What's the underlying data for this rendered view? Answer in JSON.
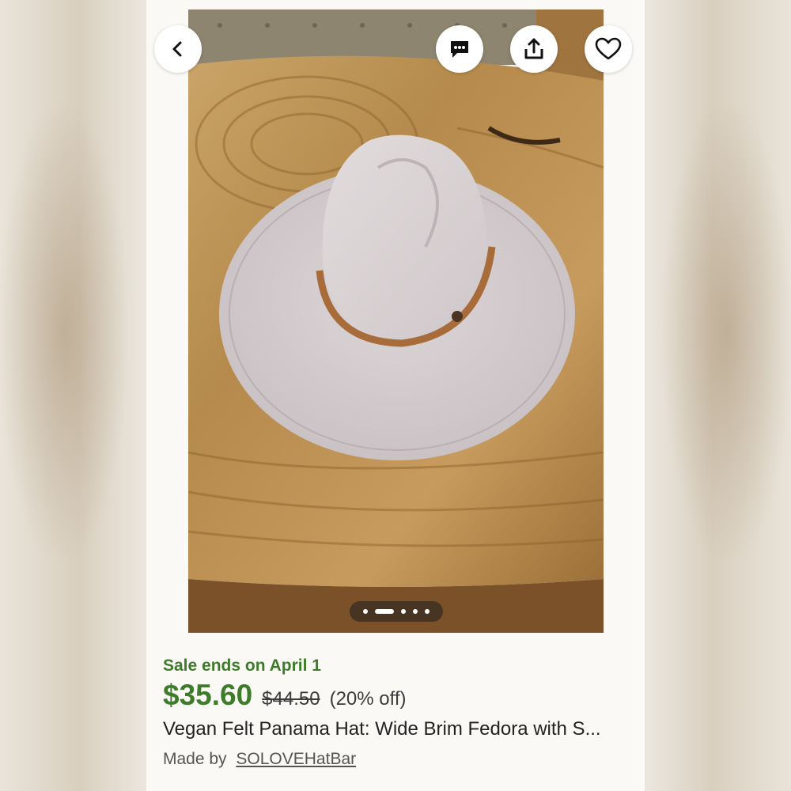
{
  "colors": {
    "sale_green": "#3e7b2a",
    "text_dark": "#222222",
    "text_muted": "#555555"
  },
  "header_buttons": [
    {
      "name": "back",
      "icon": "chevron-left-icon"
    },
    {
      "name": "message",
      "icon": "chat-bubble-icon"
    },
    {
      "name": "share",
      "icon": "share-icon"
    },
    {
      "name": "favorite",
      "icon": "heart-outline-icon"
    }
  ],
  "carousel": {
    "image_count": 5,
    "active_index": 1
  },
  "listing": {
    "sale_text": "Sale ends on April 1",
    "price": "$35.60",
    "original_price": "$44.50",
    "discount": "(20% off)",
    "title": "Vegan Felt Panama Hat: Wide Brim Fedora with S...",
    "made_by_label": "Made by",
    "shop_name": "SOLOVEHatBar"
  }
}
